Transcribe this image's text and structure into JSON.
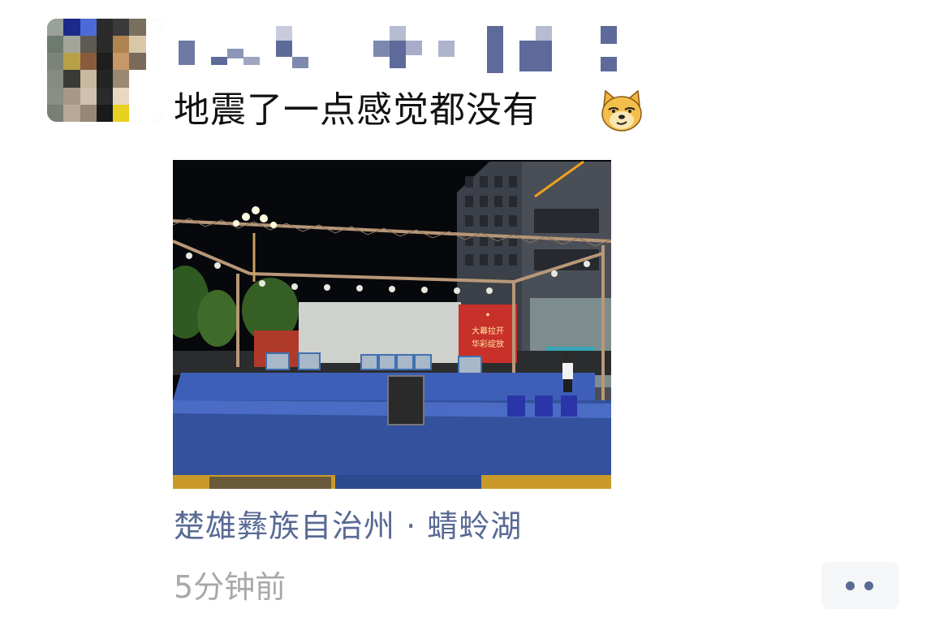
{
  "post": {
    "text": "地震了一点感觉都没有",
    "emoji": "doge-emoji",
    "location": "楚雄彝族自治州 · 蜻蛉湖",
    "time": "5分钟前"
  },
  "photo": {
    "backdrop_lines": [
      "大幕拉开",
      "华彩绽放"
    ]
  },
  "colors": {
    "link": "#586a94",
    "timestamp": "#a8a8a8",
    "more_dots": "#5a6a92",
    "stage_blue": "#3d5fb8"
  },
  "icons": {
    "more_button": "more-dots-icon"
  }
}
